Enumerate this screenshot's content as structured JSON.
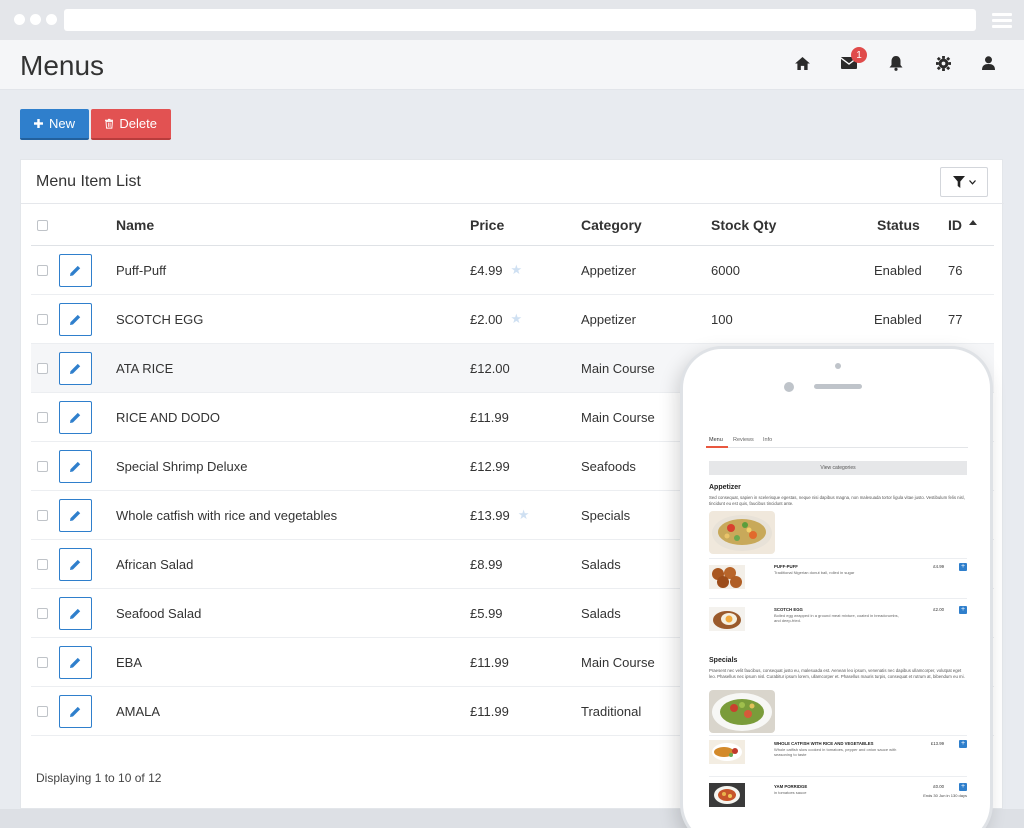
{
  "page": {
    "title": "Menus"
  },
  "header_icons": [
    "home-icon",
    "mail-icon",
    "bell-icon",
    "gear-icon",
    "user-icon"
  ],
  "mail_badge": "1",
  "toolbar": {
    "new_label": "New",
    "delete_label": "Delete"
  },
  "card": {
    "title": "Menu Item List"
  },
  "table": {
    "columns": [
      "Name",
      "Price",
      "Category",
      "Stock Qty",
      "Status",
      "ID"
    ],
    "rows": [
      {
        "name": "Puff-Puff",
        "price": "£4.99",
        "starred": true,
        "category": "Appetizer",
        "stock": "6000",
        "status": "Enabled",
        "id": "76"
      },
      {
        "name": "SCOTCH EGG",
        "price": "£2.00",
        "starred": true,
        "category": "Appetizer",
        "stock": "100",
        "status": "Enabled",
        "id": "77"
      },
      {
        "name": "ATA RICE",
        "price": "£12.00",
        "starred": false,
        "category": "Main Course",
        "stock": "",
        "status": "",
        "id": ""
      },
      {
        "name": "RICE AND DODO",
        "price": "£11.99",
        "starred": false,
        "category": "Main Course",
        "stock": "",
        "status": "",
        "id": ""
      },
      {
        "name": "Special Shrimp Deluxe",
        "price": "£12.99",
        "starred": false,
        "category": "Seafoods",
        "stock": "",
        "status": "",
        "id": ""
      },
      {
        "name": "Whole catfish with rice and vegetables",
        "price": "£13.99",
        "starred": true,
        "category": "Specials",
        "stock": "",
        "status": "",
        "id": ""
      },
      {
        "name": "African Salad",
        "price": "£8.99",
        "starred": false,
        "category": "Salads",
        "stock": "",
        "status": "",
        "id": ""
      },
      {
        "name": "Seafood Salad",
        "price": "£5.99",
        "starred": false,
        "category": "Salads",
        "stock": "",
        "status": "",
        "id": ""
      },
      {
        "name": "EBA",
        "price": "£11.99",
        "starred": false,
        "category": "Main Course",
        "stock": "",
        "status": "",
        "id": ""
      },
      {
        "name": "AMALA",
        "price": "£11.99",
        "starred": false,
        "category": "Traditional",
        "stock": "",
        "status": "",
        "id": ""
      }
    ],
    "footer": "Displaying 1 to 10 of 12"
  },
  "phone": {
    "tabs": [
      "Menu",
      "Reviews",
      "Info"
    ],
    "view_categories": "View categories",
    "sections": [
      {
        "title": "Appetizer",
        "description": "Sed consequat, sapien in scelerisque egestas, neque nisi dapibus magna, non malesuada tortor ligula vitae justo. Vestibulum felis nisl, tincidunt eu est quis, faucibus tincidunt ante.",
        "items": [
          {
            "name": "PUFF-PUFF",
            "sub": "Traditional Nigerian donut ball, rolled in sugar",
            "price": "£4.99"
          },
          {
            "name": "SCOTCH EGG",
            "sub": "Boiled egg wrapped in a ground meat mixture, coated in breadcrumbs, and deep-fried.",
            "price": "£2.00"
          }
        ]
      },
      {
        "title": "Specials",
        "description": "Praesent nec velit faucibus, consequat justo eu, malesuada est. Aenean leo ipsum, venenatis nec dapibus ullamcorper, volutpat eget leo. Phasellus nec ipsum nisl. Curabitur ipsum lorem, ullamcorper et. Phasellus mauris turpis, consequat et rutrum at, bibendum eu mi.",
        "items": [
          {
            "name": "WHOLE CATFISH WITH RICE AND VEGETABLES",
            "sub": "Whole catfish slow cooked in tomatoes, pepper and onion sauce with seasoning to taste",
            "price": "£13.99",
            "note": ""
          },
          {
            "name": "YAM PORRIDGE",
            "sub": "in tomatoes sauce",
            "price": "£0.00",
            "note": "Ends 30 Jun in 130 days"
          }
        ]
      }
    ]
  }
}
